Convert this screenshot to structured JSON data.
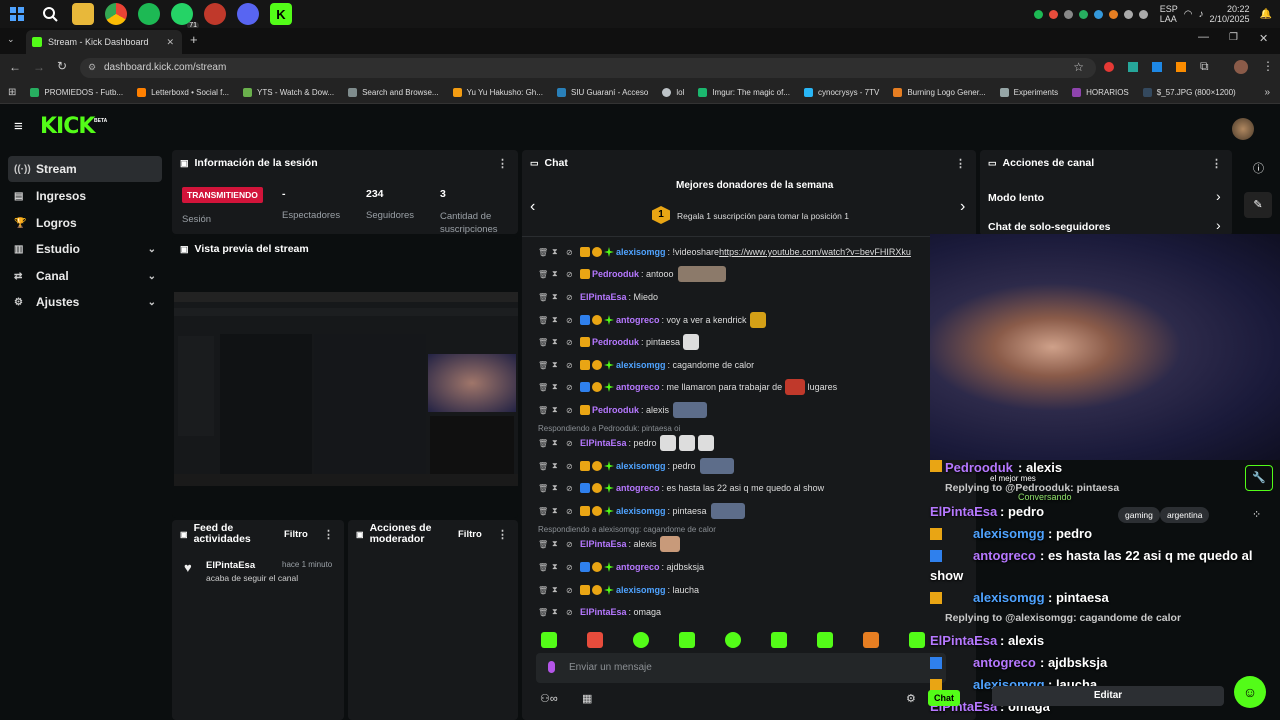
{
  "taskbar": {
    "lang": "ESP",
    "region": "LAA",
    "time": "20:22",
    "date": "2/10/2025",
    "wa_count": "71"
  },
  "browser": {
    "tab_title": "Stream - Kick Dashboard",
    "url": "dashboard.kick.com/stream",
    "bookmarks": [
      "PROMIEDOS - Futb...",
      "Letterboxd • Social f...",
      "YTS - Watch & Dow...",
      "Search and Browse...",
      "Yu Yu Hakusho: Gh...",
      "SIU Guaraní - Acceso",
      "lol",
      "Imgur: The magic of...",
      "cynocrysys - 7TV",
      "Burning Logo Gener...",
      "Experiments",
      "HORARIOS",
      "$_57.JPG (800×1200)"
    ]
  },
  "brand": {
    "logo": "KICK",
    "beta": "BETA",
    "accent": "#53fc18"
  },
  "sidebar": {
    "items": [
      {
        "label": "Stream",
        "icon": "stream-icon"
      },
      {
        "label": "Ingresos",
        "icon": "income-icon"
      },
      {
        "label": "Logros",
        "icon": "trophy-icon"
      },
      {
        "label": "Estudio",
        "icon": "studio-icon"
      },
      {
        "label": "Canal",
        "icon": "channel-icon"
      },
      {
        "label": "Ajustes",
        "icon": "gear-icon"
      }
    ]
  },
  "session": {
    "title": "Información de la sesión",
    "status": "TRANSMITIENDO",
    "status_label": "Sesión",
    "viewers": "-",
    "viewers_label": "Espectadores",
    "followers": "234",
    "followers_label": "Seguidores",
    "subs": "3",
    "subs_label": "Cantidad de suscripciones"
  },
  "preview": {
    "title": "Vista previa del stream"
  },
  "feed": {
    "title": "Feed de actividades",
    "filter": "Filtro",
    "item_user": "ElPintaEsa",
    "item_time": "hace 1 minuto",
    "item_text": "acaba de seguir el canal"
  },
  "mod": {
    "title": "Acciones de moderador",
    "filter": "Filtro"
  },
  "chat": {
    "title": "Chat",
    "donors_title": "Mejores donadores de la semana",
    "donors_text": "Regala 1 suscripción para tomar la posición 1",
    "donors_rank": "1",
    "input_placeholder": "Enviar un mensaje",
    "messages": [
      {
        "user": "alexisomgg",
        "text": ": !videoshare ",
        "link": "https://www.youtube.com/watch?v=bevFHIRXku",
        "color": "#4fa3ff"
      },
      {
        "user": "Pedrooduk",
        "text": ": antooo",
        "color": "#b678ff"
      },
      {
        "user": "ElPintaEsa",
        "text": ": Miedo",
        "color": "#b678ff"
      },
      {
        "user": "antogreco",
        "text": ": voy a ver a kendrick",
        "color": "#b678ff"
      },
      {
        "user": "Pedrooduk",
        "text": ": pintaesa",
        "color": "#b678ff"
      },
      {
        "user": "alexisomgg",
        "text": ": cagandome de calor",
        "color": "#4fa3ff"
      },
      {
        "user": "antogreco",
        "text": ": me llamaron para trabajar de",
        "text2": "lugares",
        "color": "#b678ff"
      },
      {
        "user": "Pedrooduk",
        "text": ": alexis",
        "color": "#b678ff"
      },
      {
        "user": "ElPintaEsa",
        "text": ": pedro",
        "color": "#b678ff"
      },
      {
        "user": "alexisomgg",
        "text": ": pedro",
        "color": "#4fa3ff"
      },
      {
        "user": "antogreco",
        "text": ": es hasta las 22 asi q me quedo al show",
        "color": "#b678ff"
      },
      {
        "user": "alexisomgg",
        "text": ": pintaesa",
        "color": "#4fa3ff"
      },
      {
        "user": "ElPintaEsa",
        "text": ": alexis",
        "color": "#b678ff"
      },
      {
        "user": "antogreco",
        "text": ": ajdbsksja",
        "color": "#b678ff"
      },
      {
        "user": "alexisomgg",
        "text": ": laucha",
        "color": "#4fa3ff"
      },
      {
        "user": "ElPintaEsa",
        "text": ": omaga",
        "color": "#b678ff"
      }
    ],
    "reply1": "Respondiendo a Pedrooduk: pintaesa oi",
    "reply2": "Respondiendo a alexisomgg: cagandome de calor"
  },
  "channel": {
    "title": "Acciones de canal",
    "slow": "Modo lento",
    "followers_only": "Chat de solo-seguidores"
  },
  "overlay": {
    "pedro_name": "Pedrooduk",
    "pedro_text": ": alexis",
    "label_best": "el mejor mes",
    "reply1": "Replying to @Pedrooduk: pintaesa",
    "conversando": "Conversando",
    "pinta_name": "ElPintaEsa",
    "pinta_text": ": pedro",
    "tags": [
      "gaming",
      "argentina"
    ],
    "alexis_name": "alexisomgg",
    "alexis_text": ": pedro",
    "anto_name": "antogreco",
    "anto_text": ": es hasta las 22 asi q me quedo al",
    "anto_cont": "show",
    "alexis2_text": ": pintaesa",
    "reply2": "Replying to @alexisomgg: cagandome de calor",
    "pinta2_text": ": alexis",
    "anto2_text": ": ajdbsksja",
    "alexis3_text": ": laucha",
    "pinta3_text": ": omaga",
    "chat_btn": "Chat",
    "edit_btn": "Editar"
  }
}
